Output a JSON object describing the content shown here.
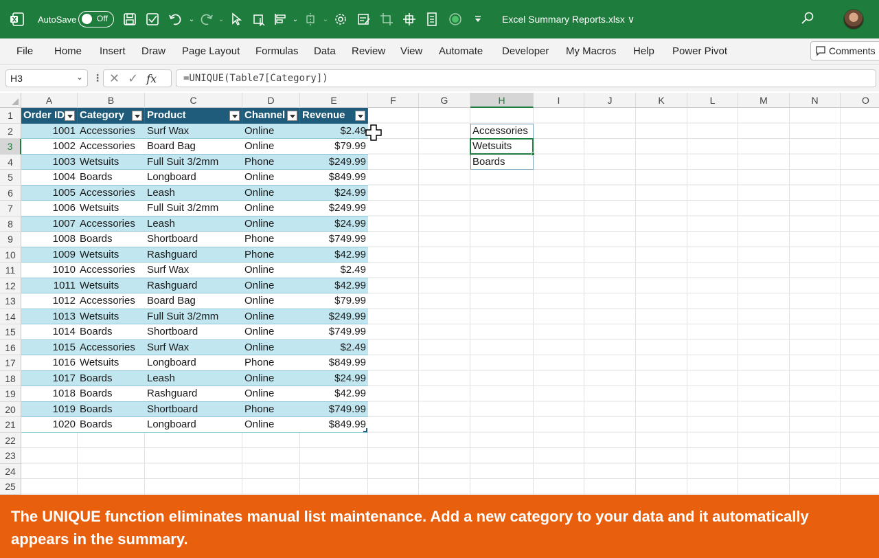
{
  "titlebar": {
    "autosave_label": "AutoSave",
    "autosave_state": "Off",
    "document_title": "Excel Summary Reports.xlsx ∨",
    "accent_color": "#1e7d3c"
  },
  "ribbon": {
    "tabs": [
      "File",
      "Home",
      "Insert",
      "Draw",
      "Page Layout",
      "Formulas",
      "Data",
      "Review",
      "View",
      "Automate",
      "Developer",
      "My Macros",
      "Help",
      "Power Pivot"
    ],
    "comments_label": "Comments"
  },
  "formula_bar": {
    "name_box": "H3",
    "fx_label": "fx",
    "formula": "=UNIQUE(Table7[Category])"
  },
  "grid": {
    "columns": [
      "A",
      "B",
      "C",
      "D",
      "E",
      "F",
      "G",
      "H",
      "I",
      "J",
      "K",
      "L",
      "M",
      "N",
      "O"
    ],
    "rows": [
      "1",
      "2",
      "3",
      "4",
      "5",
      "6",
      "7",
      "8",
      "9",
      "10",
      "11",
      "12",
      "13",
      "14",
      "15",
      "16",
      "17",
      "18",
      "19",
      "20",
      "21",
      "22",
      "23",
      "24",
      "25"
    ],
    "selected_column": "H",
    "selected_row": "3"
  },
  "table": {
    "name": "Table7",
    "headers": [
      "Order ID",
      "Category",
      "Product",
      "Channel",
      "Revenue"
    ],
    "header_color": "#1f5c7b",
    "band_color": "#c1e6f0",
    "rows": [
      [
        "1001",
        "Accessories",
        "Surf Wax",
        "Online",
        "$2.49"
      ],
      [
        "1002",
        "Accessories",
        "Board Bag",
        "Online",
        "$79.99"
      ],
      [
        "1003",
        "Wetsuits",
        "Full Suit 3/2mm",
        "Phone",
        "$249.99"
      ],
      [
        "1004",
        "Boards",
        "Longboard",
        "Online",
        "$849.99"
      ],
      [
        "1005",
        "Accessories",
        "Leash",
        "Online",
        "$24.99"
      ],
      [
        "1006",
        "Wetsuits",
        "Full Suit 3/2mm",
        "Online",
        "$249.99"
      ],
      [
        "1007",
        "Accessories",
        "Leash",
        "Online",
        "$24.99"
      ],
      [
        "1008",
        "Boards",
        "Shortboard",
        "Phone",
        "$749.99"
      ],
      [
        "1009",
        "Wetsuits",
        "Rashguard",
        "Phone",
        "$42.99"
      ],
      [
        "1010",
        "Accessories",
        "Surf Wax",
        "Online",
        "$2.49"
      ],
      [
        "1011",
        "Wetsuits",
        "Rashguard",
        "Online",
        "$42.99"
      ],
      [
        "1012",
        "Accessories",
        "Board Bag",
        "Online",
        "$79.99"
      ],
      [
        "1013",
        "Wetsuits",
        "Full Suit 3/2mm",
        "Online",
        "$249.99"
      ],
      [
        "1014",
        "Boards",
        "Shortboard",
        "Online",
        "$749.99"
      ],
      [
        "1015",
        "Accessories",
        "Surf Wax",
        "Online",
        "$2.49"
      ],
      [
        "1016",
        "Wetsuits",
        "Longboard",
        "Phone",
        "$849.99"
      ],
      [
        "1017",
        "Boards",
        "Leash",
        "Online",
        "$24.99"
      ],
      [
        "1018",
        "Boards",
        "Rashguard",
        "Online",
        "$42.99"
      ],
      [
        "1019",
        "Boards",
        "Shortboard",
        "Phone",
        "$749.99"
      ],
      [
        "1020",
        "Boards",
        "Longboard",
        "Online",
        "$849.99"
      ]
    ]
  },
  "unique_output": [
    "Accessories",
    "Wetsuits",
    "Boards"
  ],
  "caption": {
    "text": "The UNIQUE function eliminates manual list maintenance. Add a new category to your data and it automatically appears in the summary.",
    "background": "#e8600d"
  }
}
